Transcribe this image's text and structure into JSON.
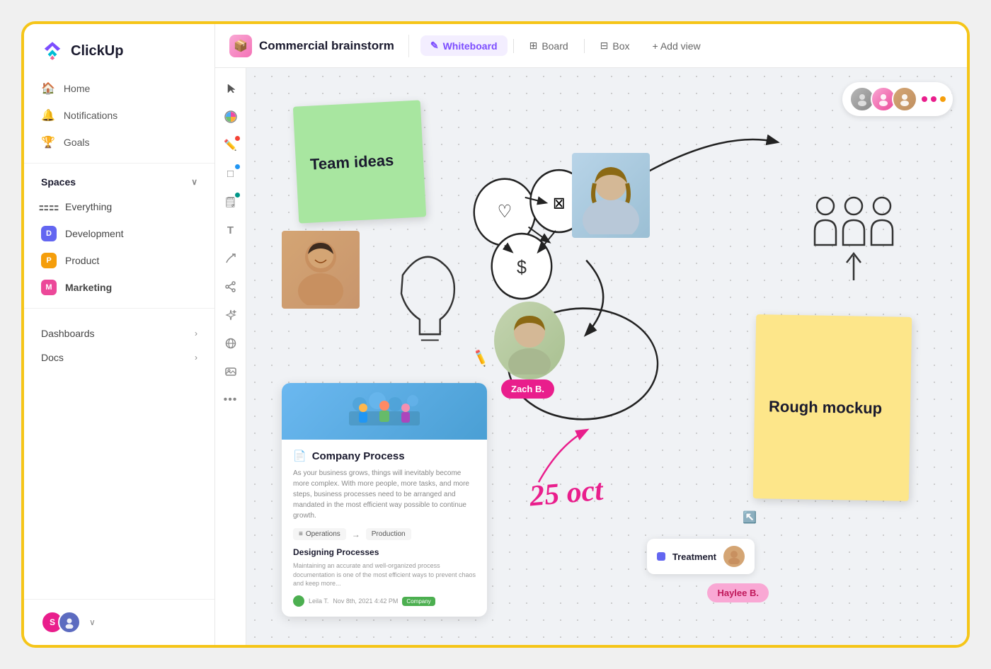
{
  "app": {
    "name": "ClickUp"
  },
  "sidebar": {
    "nav": [
      {
        "id": "home",
        "label": "Home",
        "icon": "🏠"
      },
      {
        "id": "notifications",
        "label": "Notifications",
        "icon": "🔔"
      },
      {
        "id": "goals",
        "label": "Goals",
        "icon": "🏆"
      }
    ],
    "spaces_label": "Spaces",
    "spaces": [
      {
        "id": "everything",
        "label": "Everything",
        "color": "",
        "letter": "⚏"
      },
      {
        "id": "development",
        "label": "Development",
        "color": "#6366f1",
        "letter": "D"
      },
      {
        "id": "product",
        "label": "Product",
        "color": "#f59e0b",
        "letter": "P"
      },
      {
        "id": "marketing",
        "label": "Marketing",
        "color": "#ec4899",
        "letter": "M",
        "bold": true
      }
    ],
    "dashboards_label": "Dashboards",
    "docs_label": "Docs"
  },
  "topbar": {
    "title": "Commercial brainstorm",
    "views": [
      {
        "id": "whiteboard",
        "label": "Whiteboard",
        "active": true,
        "icon": "✎"
      },
      {
        "id": "board",
        "label": "Board",
        "active": false,
        "icon": "⊞"
      },
      {
        "id": "box",
        "label": "Box",
        "active": false,
        "icon": "⊟"
      }
    ],
    "add_view_label": "+ Add view"
  },
  "canvas": {
    "sticky_green": "Team ideas",
    "sticky_yellow": "Rough mockup",
    "doc_card": {
      "title": "Company Process",
      "text": "As your business grows, things will inevitably become more complex. With more people, more tasks, and more steps, business processes need to be arranged and mandated in the most efficient way possible to continue growth.",
      "tag1": "Operations",
      "tag2": "Production",
      "section_title": "Designing Processes",
      "section_text": "Maintaining an accurate and well-organized process documentation is one of the most efficient ways to prevent chaos and keep more...",
      "footer_author": "Leila T.",
      "footer_date": "Nov 8th, 2021  4:42 PM",
      "footer_label": "Company"
    },
    "treatment_label": "Treatment",
    "name_tags": {
      "zach": "Zach B.",
      "haylee": "Haylee B."
    },
    "date_label": "25 oct",
    "avatars": [
      "👤",
      "👤",
      "👤"
    ],
    "avatar_dots": [
      "#e91e8c",
      "#e91e8c",
      "#f59e0b"
    ]
  }
}
